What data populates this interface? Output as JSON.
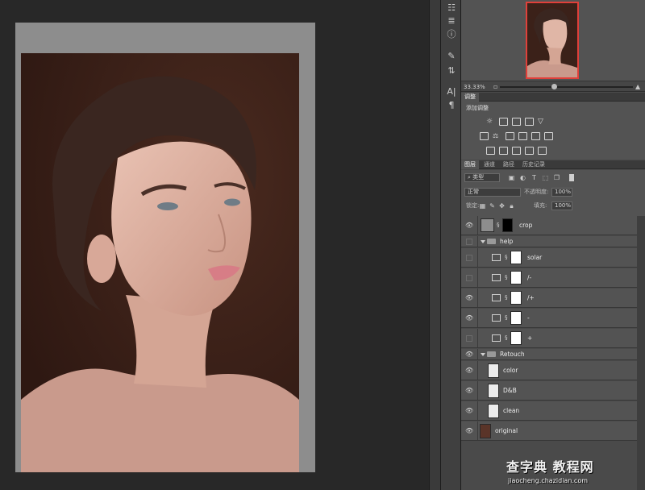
{
  "navigator": {
    "zoom": "33.33%"
  },
  "tabs": {
    "adjustments": "调整",
    "layers": "图层",
    "channels": "通道",
    "paths": "路径",
    "history": "历史记录"
  },
  "adjustments": {
    "add_label": "添加调整"
  },
  "layers_panel": {
    "filter_kind": "类型",
    "blend_mode": "正常",
    "opacity_label": "不透明度:",
    "opacity_value": "100%",
    "lock_label": "锁定:",
    "fill_label": "填充:",
    "fill_value": "100%"
  },
  "layers": [
    {
      "name": "crop",
      "visible": true,
      "kind": "fill-mask"
    },
    {
      "name": "help",
      "visible": false,
      "kind": "group"
    },
    {
      "name": "solar",
      "visible": false,
      "kind": "adjust"
    },
    {
      "name": "/-",
      "visible": false,
      "kind": "adjust"
    },
    {
      "name": "/+",
      "visible": true,
      "kind": "adjust"
    },
    {
      "name": "-",
      "visible": true,
      "kind": "adjust"
    },
    {
      "name": "+",
      "visible": false,
      "kind": "adjust"
    },
    {
      "name": "Retouch",
      "visible": true,
      "kind": "group"
    },
    {
      "name": "color",
      "visible": true,
      "kind": "pixel"
    },
    {
      "name": "D&B",
      "visible": true,
      "kind": "pixel"
    },
    {
      "name": "clean",
      "visible": true,
      "kind": "pixel"
    },
    {
      "name": "original",
      "visible": true,
      "kind": "photo"
    }
  ],
  "watermark": {
    "main": "查字典 教程网",
    "sub": "jiaocheng.chazidian.com"
  },
  "icons": {
    "eye": "eye-icon",
    "chain": "chain-link-icon",
    "folder": "folder-icon"
  },
  "colors": {
    "nav_frame": "#e0403a",
    "panel_bg": "#535353",
    "canvas_bg": "#282828"
  }
}
